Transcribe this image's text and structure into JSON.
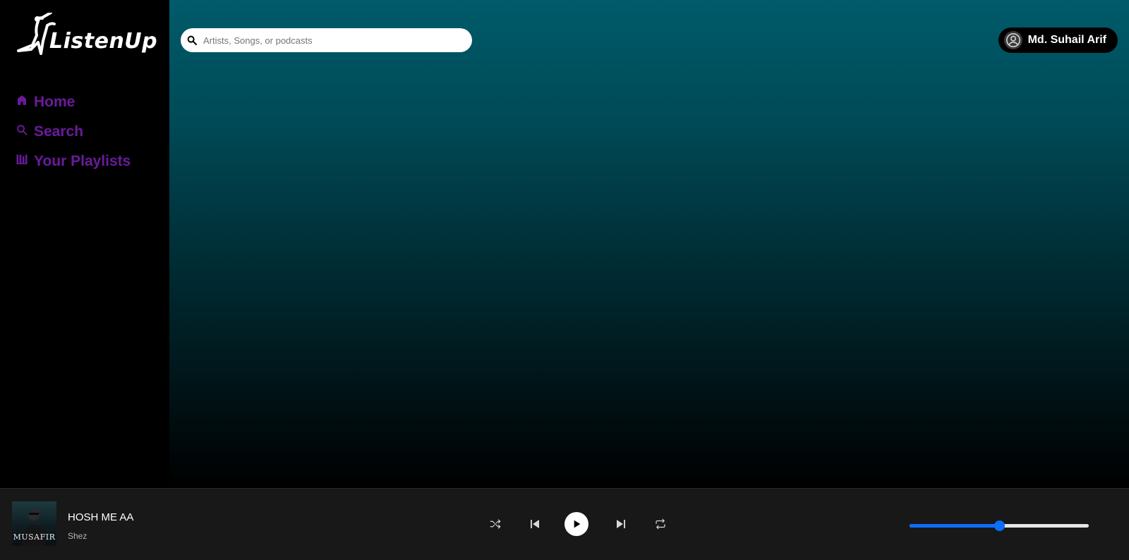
{
  "app": {
    "logo_text": "ListenUp"
  },
  "sidebar": {
    "items": [
      {
        "label": "Home",
        "icon": "home-icon"
      },
      {
        "label": "Search",
        "icon": "search-icon"
      },
      {
        "label": "Your Playlists",
        "icon": "library-icon"
      }
    ]
  },
  "header": {
    "search_placeholder": "Artists, Songs, or podcasts",
    "search_value": "",
    "user_name": "Md. Suhail Arif"
  },
  "player": {
    "cover_text": "MUSAFIR",
    "track_title": "HOSH ME AA",
    "track_artist": "Shez",
    "volume": 0.5
  },
  "colors": {
    "nav_text": "#6a1b9a",
    "player_bg": "#181818",
    "accent": "#0d6efd"
  }
}
